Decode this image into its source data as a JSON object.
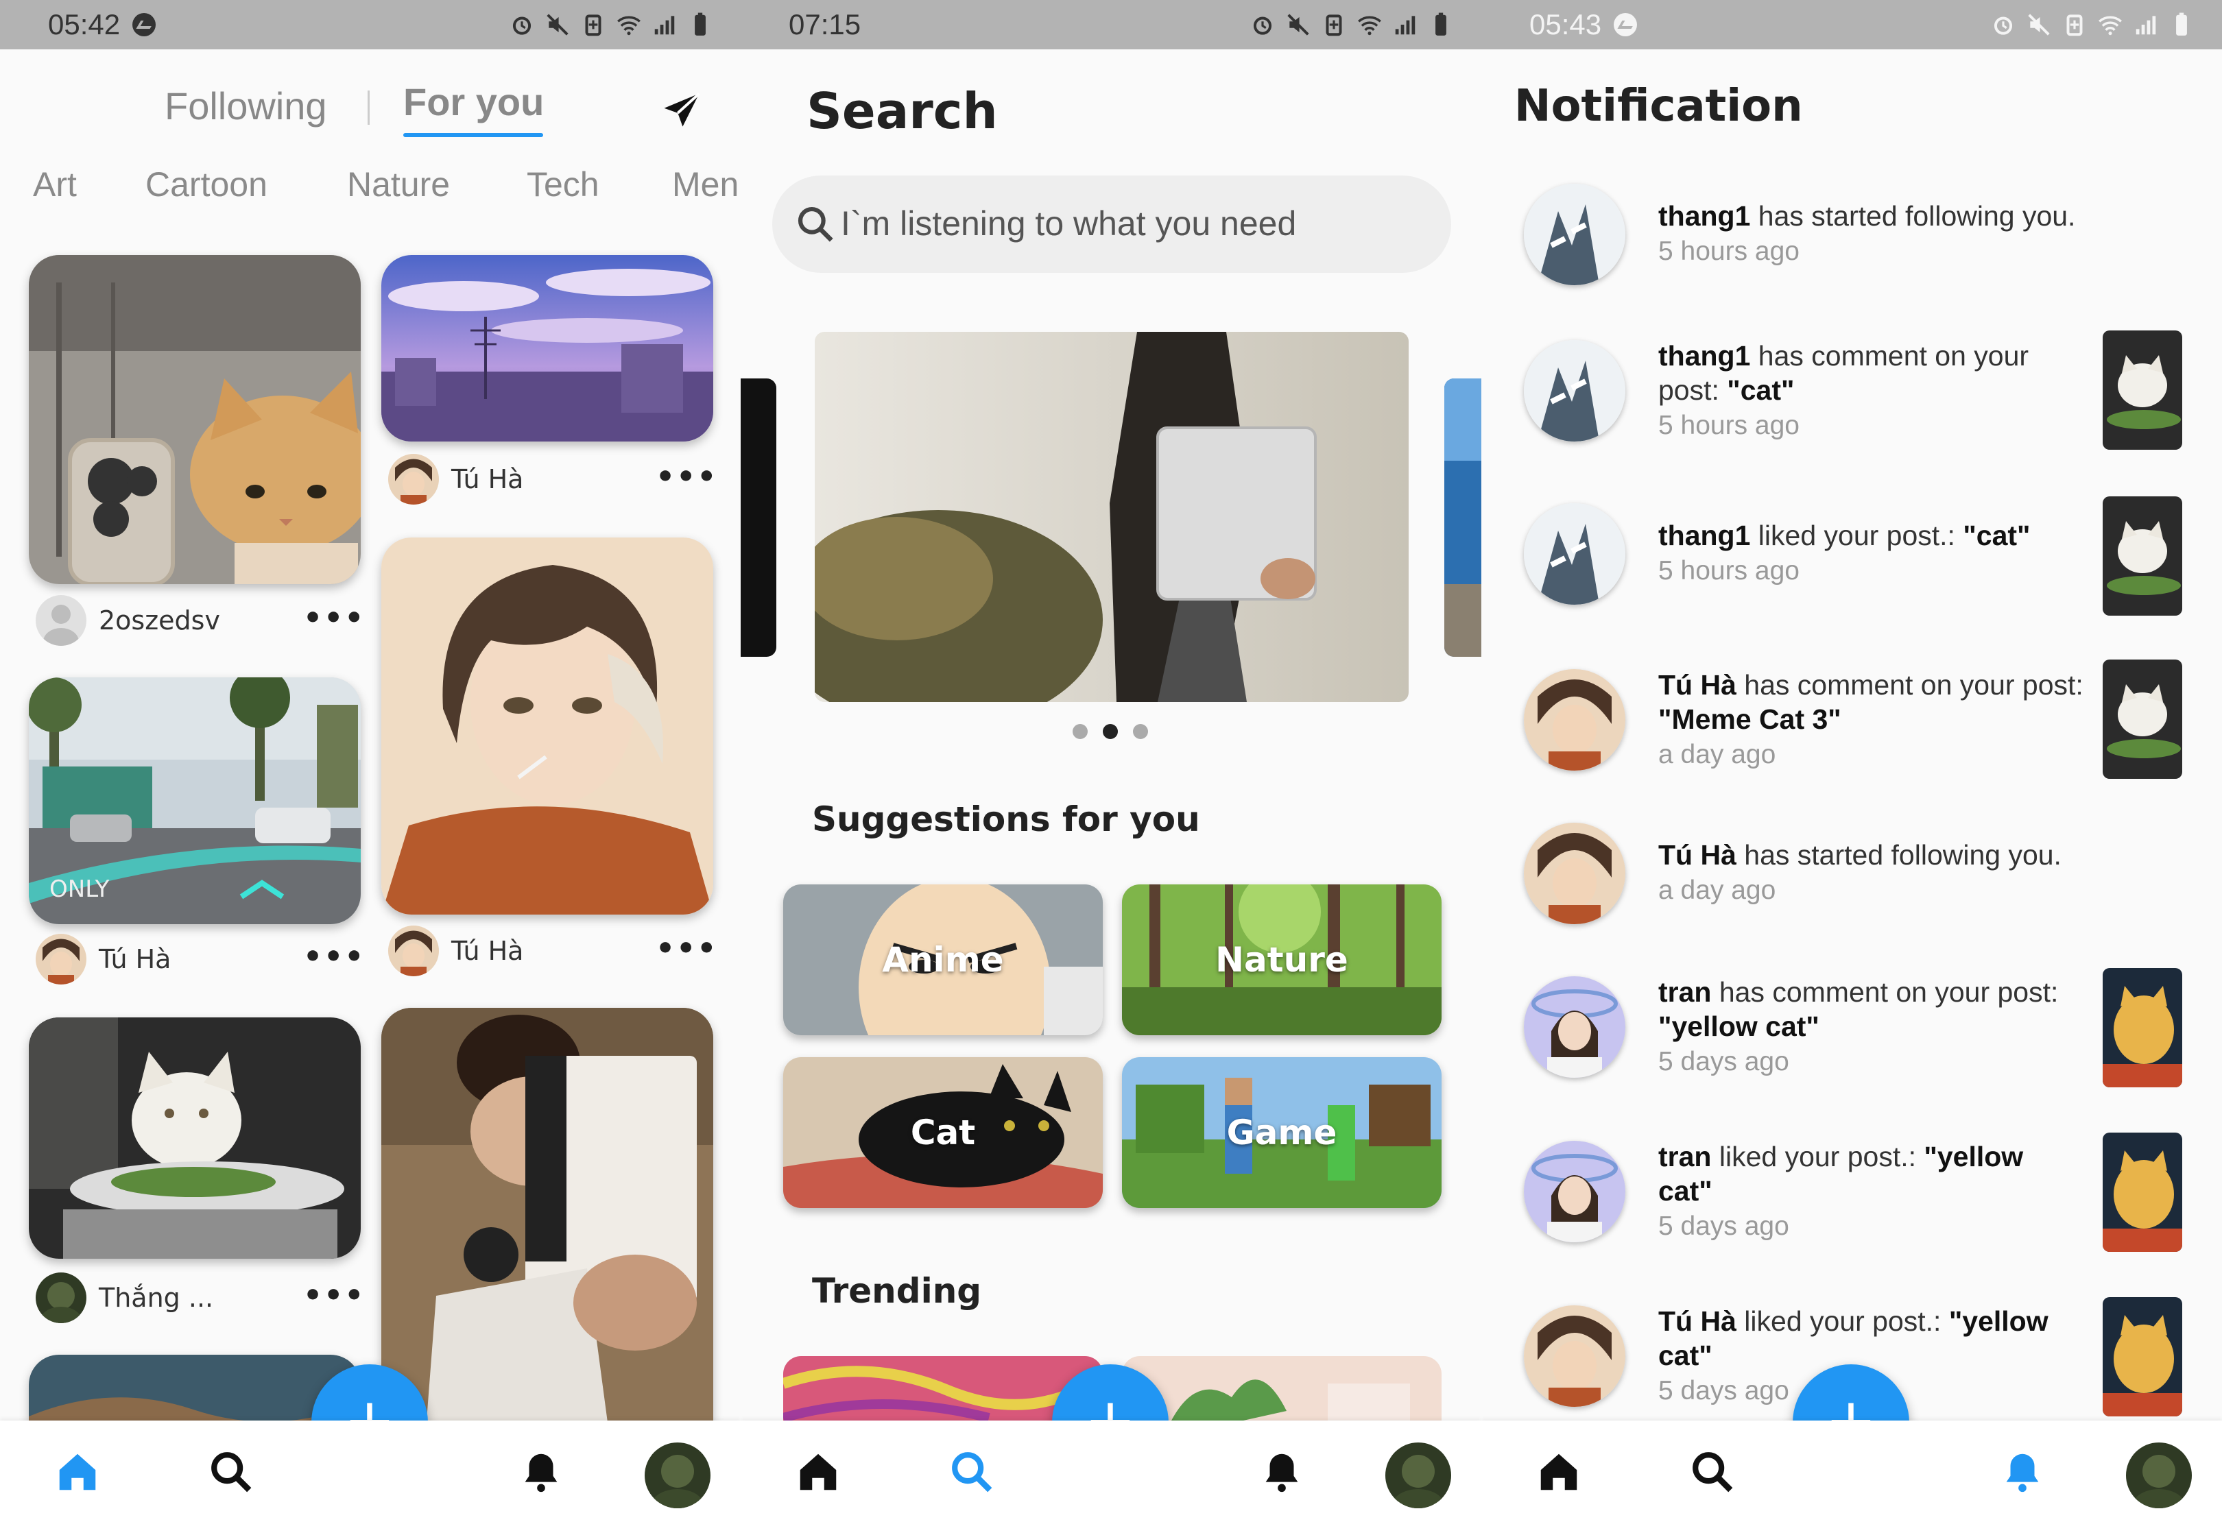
{
  "colors": {
    "accent": "#2196f3",
    "statusbar": "#b3b3b3"
  },
  "feed": {
    "status_time": "05:42",
    "tabs": [
      "Following",
      "For you"
    ],
    "active_tab": "For you",
    "categories": [
      "Art",
      "Cartoon",
      "Nature",
      "Tech",
      "Men"
    ],
    "posts": [
      {
        "author": "2oszedsv",
        "image": "cat-with-phone"
      },
      {
        "author": "Tú Hà",
        "image": "purple-anime-sky"
      },
      {
        "author": "Tú Hà",
        "image": "street-navigation"
      },
      {
        "author": "Tú Hà",
        "image": "anime-boy-portrait"
      },
      {
        "author": "Thắng ...",
        "image": "cat-at-dinner-table"
      },
      {
        "author": "",
        "image": "person-with-card"
      }
    ],
    "more_label": "•••",
    "fab_label": "+"
  },
  "search": {
    "status_time": "07:15",
    "title": "Search",
    "placeholder": "I`m listening to what you need",
    "suggestions_title": "Suggestions for you",
    "suggestions": [
      "Anime",
      "Nature",
      "Cat",
      "Game"
    ],
    "trending_title": "Trending",
    "carousel_dots": 3,
    "carousel_active": 1,
    "fab_label": "+"
  },
  "notifications": {
    "status_time": "05:43",
    "title": "Notification",
    "items": [
      {
        "user": "thang1",
        "before": " has started following you.",
        "quoted": "",
        "after": "",
        "time": "5 hours ago",
        "avatar": "snowy-tree",
        "thumb": ""
      },
      {
        "user": "thang1",
        "before": " has comment on your post: ",
        "quoted": "\"cat\"",
        "after": "",
        "time": "5 hours ago",
        "avatar": "snowy-tree",
        "thumb": "cat-dinner"
      },
      {
        "user": "thang1",
        "before": " liked your post.: ",
        "quoted": "\"cat\"",
        "after": "",
        "time": "5 hours ago",
        "avatar": "snowy-tree",
        "thumb": "cat-dinner"
      },
      {
        "user": "Tú Hà",
        "before": " has comment on your post: ",
        "quoted": "\"Meme Cat 3\"",
        "after": "",
        "time": "a day ago",
        "avatar": "anime-boy",
        "thumb": "cat-dinner"
      },
      {
        "user": "Tú Hà",
        "before": " has started following you.",
        "quoted": "",
        "after": "",
        "time": "a day ago",
        "avatar": "anime-boy",
        "thumb": ""
      },
      {
        "user": "tran",
        "before": " has comment on your post: ",
        "quoted": "\"yellow cat\"",
        "after": "",
        "time": "5 days ago",
        "avatar": "girl-portrait",
        "thumb": "yellow-cat"
      },
      {
        "user": "tran",
        "before": " liked your post.: ",
        "quoted": "\"yellow",
        "after": " cat\"",
        "time": "5 days ago",
        "avatar": "girl-portrait",
        "thumb": "yellow-cat"
      },
      {
        "user": "Tú Hà",
        "before": " liked your post.: ",
        "quoted": "\"yellow",
        "after": " cat\"",
        "time": "5 days ago",
        "avatar": "anime-boy",
        "thumb": "yellow-cat"
      }
    ],
    "fab_label": "+"
  }
}
